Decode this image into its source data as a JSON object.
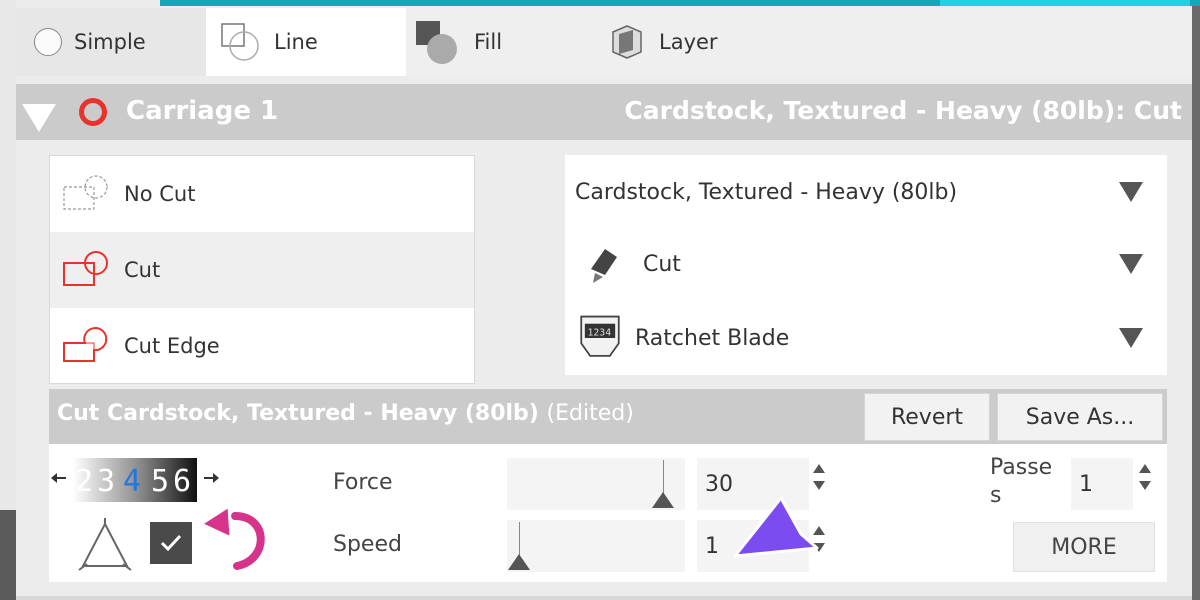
{
  "tabs": [
    {
      "label": "Simple",
      "icon": "radio-circle-icon"
    },
    {
      "label": "Line",
      "icon": "line-style-icon"
    },
    {
      "label": "Fill",
      "icon": "fill-style-icon"
    },
    {
      "label": "Layer",
      "icon": "layer-icon"
    }
  ],
  "carriage": {
    "title": "Carriage 1",
    "material_summary": "Cardstock, Textured - Heavy (80lb): Cut",
    "ring_color": "#e8332c"
  },
  "cut_options": [
    {
      "label": "No Cut",
      "icon": "no-cut-icon"
    },
    {
      "label": "Cut",
      "icon": "cut-icon",
      "selected": true
    },
    {
      "label": "Cut Edge",
      "icon": "cut-edge-icon"
    }
  ],
  "dropdowns": {
    "material": "Cardstock, Textured - Heavy (80lb)",
    "action": "Cut",
    "tool": "Ratchet Blade"
  },
  "settings": {
    "title": "Cut Cardstock, Textured - Heavy (80lb)",
    "edited": "(Edited)",
    "revert_label": "Revert",
    "save_as_label": "Save As...",
    "blade_digits": [
      "2",
      "3",
      "4",
      "5",
      "6"
    ],
    "force_label": "Force",
    "force_value": "30",
    "speed_label": "Speed",
    "speed_value": "1",
    "passes_label_line1": "Passe",
    "passes_label_line2": "s",
    "passes_value": "1",
    "more_label": "MORE",
    "checkbox_checked": true
  },
  "colors": {
    "accent_teal": "#11a9b8",
    "cut_red": "#e8332c",
    "annotation_pink": "#d6338a",
    "annotation_purple": "#7b4df0"
  }
}
